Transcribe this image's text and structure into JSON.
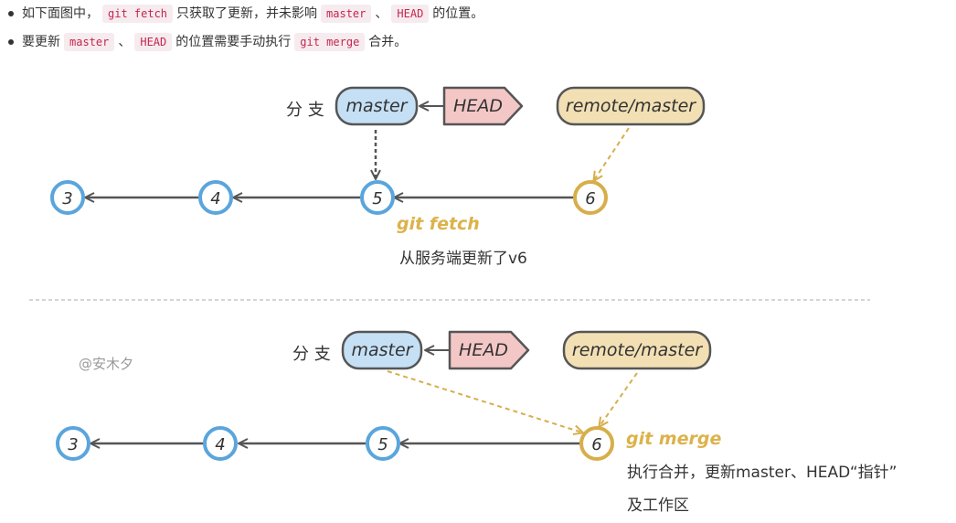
{
  "notes": {
    "line1": {
      "t1": "如下面图中，",
      "c1": "git fetch",
      "t2": "只获取了更新，并未影响",
      "c2": "master",
      "t3": "、",
      "c3": "HEAD",
      "t4": "的位置。"
    },
    "line2": {
      "t1": "要更新",
      "c1": "master",
      "t2": "、",
      "c2": "HEAD",
      "t3": "的位置需要手动执行",
      "c3": "git merge",
      "t4": "合并。"
    }
  },
  "diagram_top": {
    "branch_label": "分 支",
    "master": "master",
    "head": "HEAD",
    "remote": "remote/master",
    "commits": [
      "3",
      "4",
      "5",
      "6"
    ],
    "action": "git fetch",
    "caption": "从服务端更新了v6"
  },
  "diagram_bottom": {
    "branch_label": "分 支",
    "master": "master",
    "head": "HEAD",
    "remote": "remote/master",
    "commits": [
      "3",
      "4",
      "5",
      "6"
    ],
    "action": "git merge",
    "caption_line1": "执行合并，更新master、HEAD“指针”",
    "caption_line2": "及工作区"
  },
  "watermark": "@安木夕",
  "colors": {
    "blue_node": "#5aa5dc",
    "gold_node": "#d7ae4a",
    "master_fill": "#c5e0f5",
    "head_fill": "#f4c7c7",
    "remote_fill": "#f2e0b4",
    "action_text": "#dcb24a",
    "line": "#555555"
  }
}
